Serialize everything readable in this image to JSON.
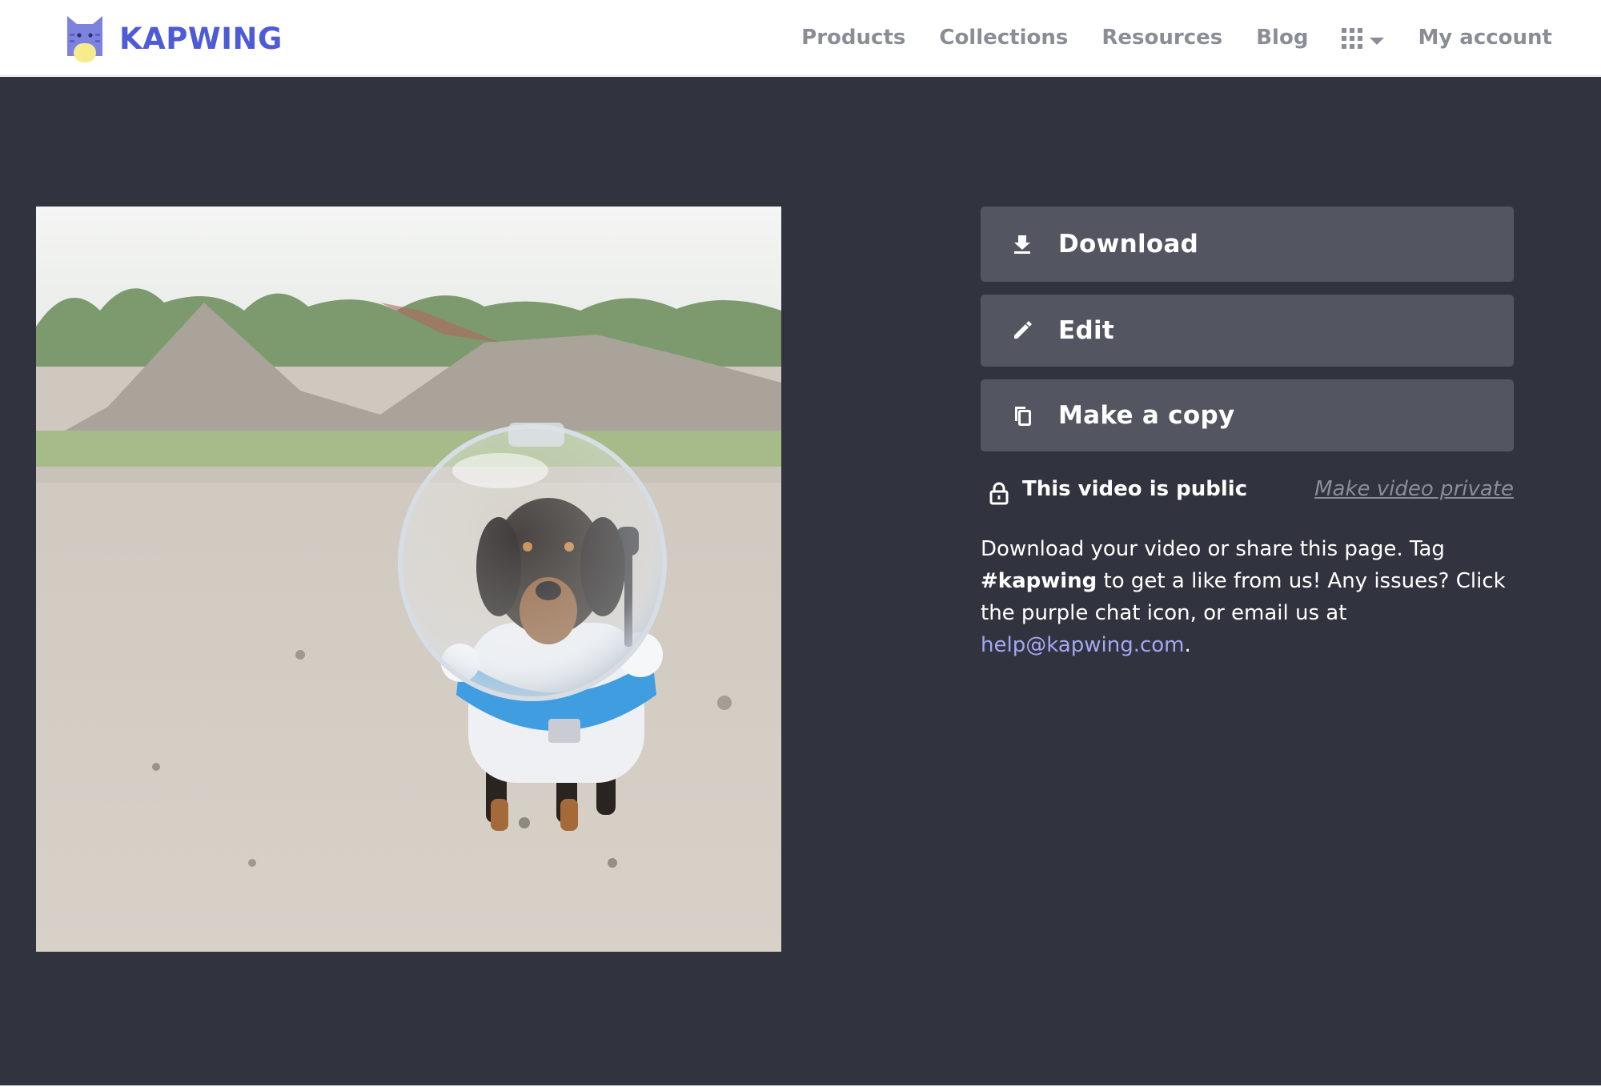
{
  "brand": {
    "name": "KAPWING",
    "logo_icon": "kapwing-cat-icon",
    "color": "#4f5bd5"
  },
  "nav": {
    "items": [
      {
        "label": "Products"
      },
      {
        "label": "Collections"
      },
      {
        "label": "Resources"
      },
      {
        "label": "Blog"
      }
    ],
    "apps_icon": "grid-icon",
    "apps_caret_icon": "caret-down-icon",
    "account_label": "My account"
  },
  "preview": {
    "icon": "video-thumbnail-dachshund-astronaut"
  },
  "actions": {
    "download": {
      "label": "Download",
      "icon": "download-icon"
    },
    "edit": {
      "label": "Edit",
      "icon": "pencil-icon"
    },
    "copy": {
      "label": "Make a copy",
      "icon": "copy-icon"
    }
  },
  "privacy": {
    "icon": "lock-icon",
    "status": "This video is public",
    "toggle_link": "Make video private"
  },
  "help": {
    "text_1": "Download your video or share this page. Tag ",
    "tag": "#kapwing",
    "text_2": " to get a like from us! Any issues? Click the purple chat icon, or email us at ",
    "email": "help@kapwing.com",
    "text_3": "."
  },
  "colors": {
    "main_background": "#31343e",
    "button_background": "#535661",
    "nav_text": "#8a8d96",
    "link": "#a3a8f2"
  }
}
